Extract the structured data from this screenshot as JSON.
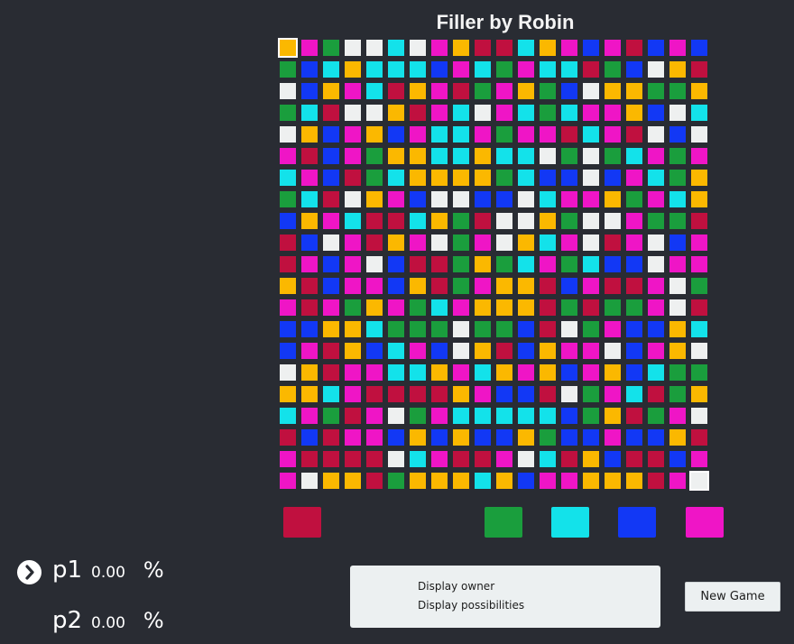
{
  "title": "Filler by Robin",
  "colors": {
    "r": "#c0103f",
    "g": "#1a9e3d",
    "c": "#13e2ea",
    "b": "#1238f5",
    "m": "#ef15c6",
    "y": "#fbb800",
    "w": "#eef0f0"
  },
  "board": {
    "rows": [
      "ymgwwcwmyrrcymbmrbmb",
      "gbcycccbmcgmccrgbwyr",
      "wbymcrymrgmygbwyyggy",
      "gcrwwyrmcwmcgcmmybwc",
      "wybmybmccmgmmrcmrwbw",
      "mrbmgyyccyccwgwgcmgm",
      "cmbrgcyyyygcbbwbmcgy",
      "gcrwymbwwbbwcmmygmcy",
      "bymcrrcygrwwygwwmggr",
      "rbwmrymwgmwycmwrmwbm",
      "rmbmwbrrgygcmgcbbwmm",
      "yrbmmbyrgmyyrbmrrmwg",
      "mrmgymgcmyyyrgrggmwr",
      "bbyycgggwggbrwgmbbyc",
      "bmrybcmbwyrbymmwbmyw",
      "wyrmmccymcymybmybcgg",
      "yycmrrrrymbbrwgmcrgy",
      "cmgrmwgmcccccbgyrgmw",
      "rbrmmbybybbygbbmbbyr",
      "mrrrrwcmrrmwcrybrrbm",
      "mwyyrgyyycybmmyyyrmw"
    ]
  },
  "palette": [
    {
      "key": "r",
      "color": "#c0103f"
    },
    {
      "key": "g",
      "color": "#1a9e3d"
    },
    {
      "key": "c",
      "color": "#13e2ea"
    },
    {
      "key": "b",
      "color": "#1238f5"
    },
    {
      "key": "m",
      "color": "#ef15c6"
    }
  ],
  "players": [
    {
      "name": "p1",
      "score": "0.00",
      "unit": "%"
    },
    {
      "name": "p2",
      "score": "0.00",
      "unit": "%"
    }
  ],
  "options": {
    "owner": "Display owner",
    "possibilities": "Display possibilities"
  },
  "new_game_label": "New Game"
}
